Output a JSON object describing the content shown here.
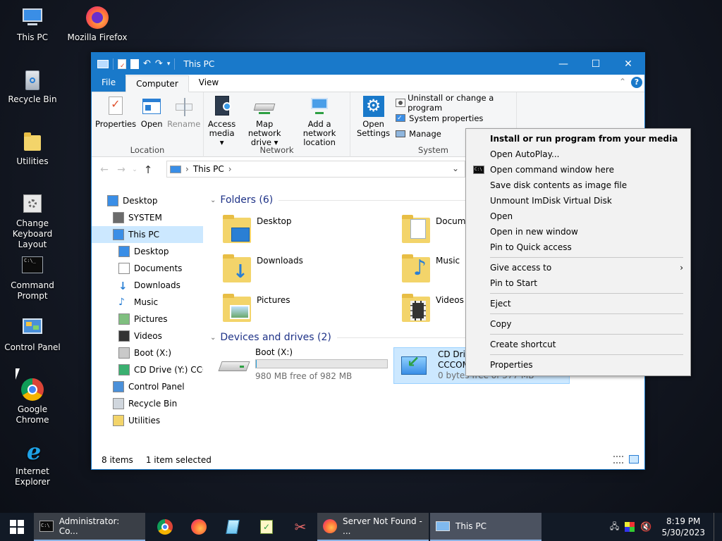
{
  "desktop": {
    "icons": [
      {
        "label": "This PC",
        "icon": "this-pc-icon"
      },
      {
        "label": "Mozilla Firefox",
        "icon": "firefox-icon"
      },
      {
        "label": "Recycle Bin",
        "icon": "recycle-bin-icon"
      },
      {
        "label": "Utilities",
        "icon": "folder-icon"
      },
      {
        "label": "Change Keyboard Layout",
        "icon": "keyboard-layout-icon"
      },
      {
        "label": "Command Prompt",
        "icon": "command-prompt-icon"
      },
      {
        "label": "Control Panel",
        "icon": "control-panel-icon"
      },
      {
        "label": "Google Chrome",
        "icon": "chrome-icon"
      },
      {
        "label": "Internet Explorer",
        "icon": "internet-explorer-icon"
      }
    ]
  },
  "window": {
    "title": "This PC",
    "controls": {
      "minimize": "—",
      "maximize": "☐",
      "close": "✕"
    },
    "tabs": {
      "file": "File",
      "computer": "Computer",
      "view": "View"
    },
    "ribbon": {
      "location": {
        "label": "Location",
        "properties": "Properties",
        "open": "Open",
        "rename": "Rename"
      },
      "network": {
        "label": "Network",
        "access_media_1": "Access",
        "access_media_2": "media ▾",
        "map_drive_1": "Map network",
        "map_drive_2": "drive ▾",
        "add_location_1": "Add a network",
        "add_location_2": "location"
      },
      "system": {
        "label": "System",
        "open_settings_1": "Open",
        "open_settings_2": "Settings",
        "uninstall": "Uninstall or change a program",
        "system_properties": "System properties",
        "manage": "Manage"
      }
    },
    "address": {
      "path": "This PC",
      "separator": "›"
    },
    "nav": [
      {
        "label": "Desktop",
        "icon": "desktop-icon",
        "indent": 0,
        "selected": false
      },
      {
        "label": "SYSTEM",
        "icon": "user-icon",
        "indent": 1,
        "selected": false
      },
      {
        "label": "This PC",
        "icon": "this-pc-icon",
        "indent": 1,
        "selected": true
      },
      {
        "label": "Desktop",
        "icon": "desktop-icon",
        "indent": 2,
        "selected": false
      },
      {
        "label": "Documents",
        "icon": "documents-icon",
        "indent": 2,
        "selected": false
      },
      {
        "label": "Downloads",
        "icon": "downloads-icon",
        "indent": 2,
        "selected": false
      },
      {
        "label": "Music",
        "icon": "music-icon",
        "indent": 2,
        "selected": false
      },
      {
        "label": "Pictures",
        "icon": "pictures-icon",
        "indent": 2,
        "selected": false
      },
      {
        "label": "Videos",
        "icon": "videos-icon",
        "indent": 2,
        "selected": false
      },
      {
        "label": "Boot (X:)",
        "icon": "drive-icon",
        "indent": 2,
        "selected": false
      },
      {
        "label": "CD Drive (Y:) CCC",
        "icon": "cd-drive-icon",
        "indent": 2,
        "selected": false
      },
      {
        "label": "Control Panel",
        "icon": "control-panel-icon",
        "indent": 1,
        "selected": false
      },
      {
        "label": "Recycle Bin",
        "icon": "recycle-bin-icon",
        "indent": 1,
        "selected": false
      },
      {
        "label": "Utilities",
        "icon": "folder-icon",
        "indent": 1,
        "selected": false
      }
    ],
    "folders_header": "Folders (6)",
    "folders": [
      "Desktop",
      "Documents",
      "Downloads",
      "Music",
      "Pictures",
      "Videos"
    ],
    "devices_header": "Devices and drives (2)",
    "drives": [
      {
        "name": "Boot (X:)",
        "free": "980 MB free of 982 MB",
        "used_fraction": 0.002
      },
      {
        "name": "CD Drive",
        "line2": "CCCOM",
        "free": "0 bytes free of 377 MB",
        "used_fraction": 1.0
      }
    ],
    "status": {
      "items": "8 items",
      "selected": "1 item selected"
    }
  },
  "context_menu": {
    "items": [
      {
        "label": "Install or run program from your media",
        "bold": true
      },
      {
        "label": "Open AutoPlay..."
      },
      {
        "label": "Open command window here",
        "icon": "command-prompt-icon"
      },
      {
        "label": "Save disk contents as image file"
      },
      {
        "label": "Unmount ImDisk Virtual Disk"
      },
      {
        "label": "Open"
      },
      {
        "label": "Open in new window"
      },
      {
        "label": "Pin to Quick access"
      },
      {
        "sep": true
      },
      {
        "label": "Give access to",
        "submenu": true
      },
      {
        "label": "Pin to Start"
      },
      {
        "sep": true
      },
      {
        "label": "Eject"
      },
      {
        "sep": true
      },
      {
        "label": "Copy"
      },
      {
        "sep": true
      },
      {
        "label": "Create shortcut"
      },
      {
        "sep": true
      },
      {
        "label": "Properties"
      }
    ]
  },
  "taskbar": {
    "cmd_label": "Administrator: Co...",
    "firefox_label": "Server Not Found - ...",
    "explorer_label": "This PC",
    "time": "8:19 PM",
    "date": "5/30/2023"
  },
  "colors": {
    "accent": "#1979ca",
    "selection": "#cce8ff",
    "taskbar": "#121a26"
  }
}
